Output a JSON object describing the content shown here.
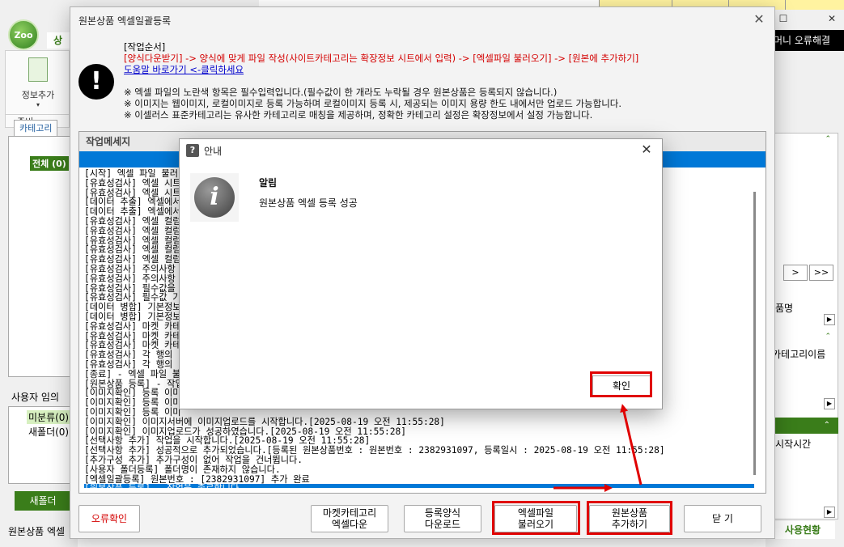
{
  "background": {
    "logo_text": "Zoo",
    "tab_label": "상품",
    "toolbar_label": "정보추가",
    "toolbar_group": "준비",
    "category_tab": "카테고리",
    "category_all": "전체 (0)",
    "user_label": "사용자 임의",
    "user_item_1": "미분류(0)",
    "user_item_2": "새폴더(0)",
    "new_folder_button": "새폴더",
    "status_left": "원본상품 엑셀",
    "black_bar_text": "머니 오류해결",
    "nav_next": ">",
    "nav_last": ">>",
    "right_label_1": "품명",
    "right_label_2": "카테고리이름",
    "right_label_3": "시작시간",
    "right_status": "사용현황"
  },
  "main_dialog": {
    "title": "원본상품 엑셀일괄등록",
    "instructions_heading": "[작업순서]",
    "instructions_steps": "[양식다운받기] -> 양식에 맞게 파일 작성(사이트카테고리는 확장정보 시트에서 입력) -> [엑셀파일 불러오기] -> [원본에 추가하기]",
    "help_link": "도움말 바로가기 <-클릭하세요",
    "notes": [
      "※ 엑셀 파일의 노란색 항목은 필수입력입니다.(필수값이 한 개라도 누락될 경우 원본상품은 등록되지 않습니다.)",
      "※ 이미지는 웹이미지, 로컬이미지로 등록 가능하며 로컬이미지 등록 시, 제공되는 이미지 용량 한도 내에서만 업로드 가능합니다.",
      "※ 이셀러스 표준카테고리는 유사한 카테고리로 매칭을 제공하며, 정확한 카테고리 설정은 확장정보에서 설정 가능합니다."
    ],
    "work_panel_title": "작업메세지",
    "log_lines": [
      "[시작] 엑셀 파일 불러",
      "[유효성검사] 엑셀 시트",
      "[유효성검사] 엑셀 시트",
      "[데이터 추출] 엑셀에서",
      "[데이터 추출] 엑셀에서",
      "[유효성검사] 엑셀 컬럼",
      "[유효성검사] 엑셀 컬럼",
      "[유효성검사] 엑셀 컬럼",
      "[유효성검사] 엑셀 컬럼",
      "[유효성검사] 엑셀 컬럼",
      "[유효성검사] 주의사항",
      "[유효성검사] 주의사항",
      "[유효성검사] 필수값을",
      "[유효성검사] 필수값 기",
      "[데이터 병합] 기본정보",
      "[데이터 병합] 기본정보",
      "[유효성검사] 마켓 카테",
      "[유효성검사] 마켓 카테",
      "[유효성검사] 마켓 카테",
      "[유효성검사] 각 행의",
      "[유효성검사] 각 행의",
      "[종료] - 엑셀 파일 불",
      "[원본상품 등록] - 작업",
      "[이미지확인] 등록 이미",
      "[이미지확인] 등록 이미",
      "[이미지확인] 등록 이미",
      "[이미지확인] 이미지서버에 이미지업로드를 시작합니다.[2025-08-19 오전 11:55:28]",
      "[이미지확인] 이미지업로드가 성공하였습니다.[2025-08-19 오전 11:55:28]",
      "[선택사항 추가] 작업을 시작합니다.[2025-08-19 오전 11:55:28]",
      "[선택사항 추가] 성공적으로 추가되었습니다.[등록된 원본상품번호 : 원본번호 : 2382931097, 등록일시 : 2025-08-19 오전 11:55:28]",
      "[추가구성 추가] 추가구성이 없어 작업을 건너뜁니다.",
      "[사용자 폴더등록] 폴더명이 존재하지 않습니다.",
      "[엑셀일괄등록] 원본번호 : [2382931097] 추가 완료",
      "[원본상품 등록] - 작업을 종료합니다."
    ],
    "buttons": {
      "error_check": "오류확인",
      "market_cat_line1": "마켓카테고리",
      "market_cat_line2": "엑셀다운",
      "form_line1": "등록양식",
      "form_line2": "다운로드",
      "excel_line1": "엑셀파일",
      "excel_line2": "불러오기",
      "add_line1": "원본상품",
      "add_line2": "추가하기",
      "close": "닫 기"
    }
  },
  "info_dialog": {
    "title": "안내",
    "heading": "알림",
    "message": "원본상품 엑셀 등록 성공",
    "confirm_button": "확인"
  },
  "colors": {
    "highlight_red": "#e00000",
    "selection_blue": "#0078d7",
    "brand_green": "#3a7d1a"
  }
}
